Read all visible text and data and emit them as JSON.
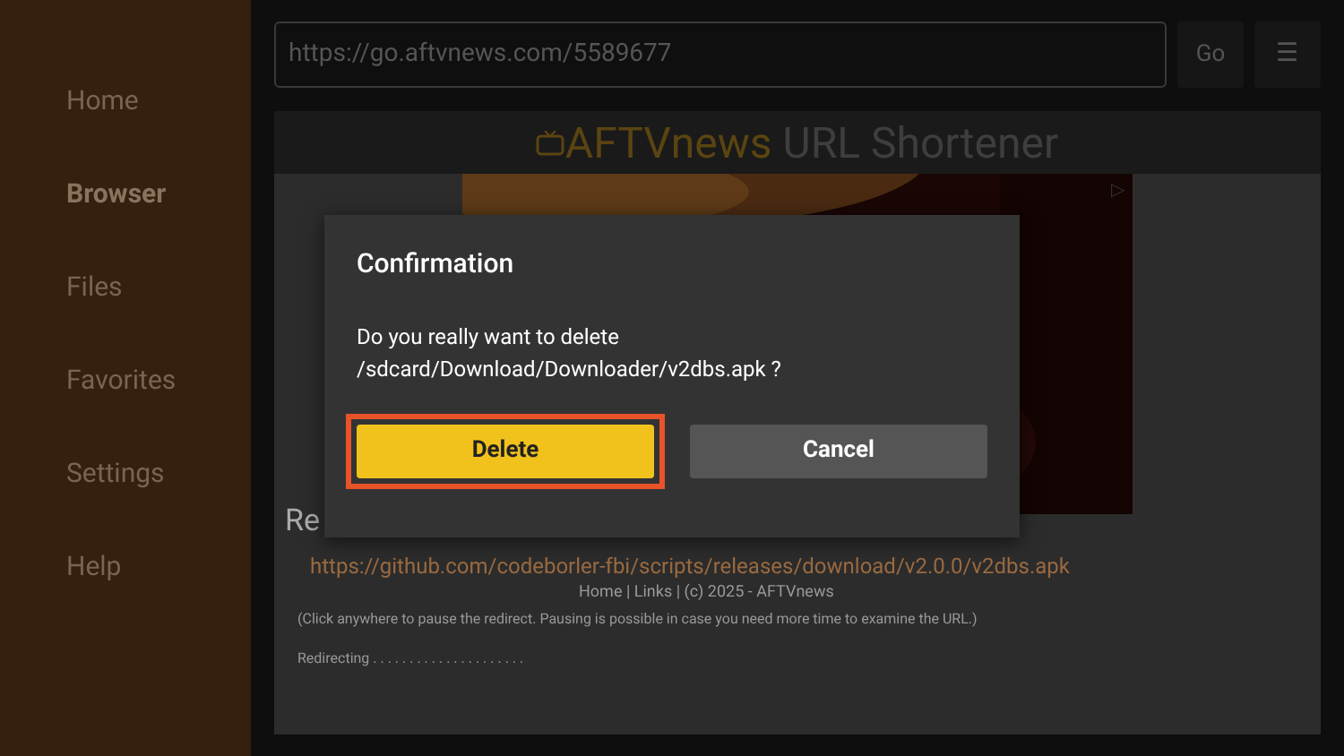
{
  "sidebar": {
    "items": [
      {
        "label": "Home",
        "selected": false
      },
      {
        "label": "Browser",
        "selected": true
      },
      {
        "label": "Files",
        "selected": false
      },
      {
        "label": "Favorites",
        "selected": false
      },
      {
        "label": "Settings",
        "selected": false
      },
      {
        "label": "Help",
        "selected": false
      }
    ]
  },
  "address_bar": {
    "value": "https://go.aftvnews.com/5589677",
    "go": "Go",
    "menu": "☰"
  },
  "page": {
    "logo_brand": "AFTVnews",
    "logo_rest": "URL Shortener",
    "ad_marker": "▷",
    "heading": "Re",
    "link": "https://github.com/codeborler-fbi/scripts/releases/download/v2.0.0/v2dbs.apk",
    "footer": "Home | Links | (c) 2025 - AFTVnews",
    "note": "(Click anywhere to pause the redirect. Pausing is possible in case you need more time to examine the URL.)",
    "status": "Redirecting . . . . . . . . . . . . . . . . . . . . ."
  },
  "dialog": {
    "title": "Confirmation",
    "message": "Do you really want to delete /sdcard/Download/Downloader/v2dbs.apk ?",
    "buttons": [
      {
        "label": "Delete",
        "kind": "primary",
        "focused": true
      },
      {
        "label": "Cancel",
        "kind": "secondary",
        "focused": false
      }
    ]
  }
}
